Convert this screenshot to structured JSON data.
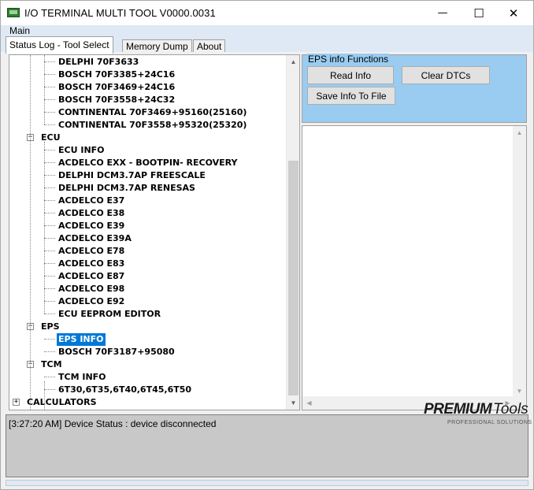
{
  "window": {
    "title": "I/O TERMINAL MULTI TOOL V0000.0031",
    "minimize_glyph": "—",
    "maximize_glyph": "☐",
    "close_glyph": "✕"
  },
  "menu": {
    "main_label": "Main"
  },
  "tabs": [
    {
      "label": "Status Log - Tool Select",
      "active": true
    },
    {
      "label": "Memory Dump",
      "active": false
    },
    {
      "label": "About",
      "active": false
    }
  ],
  "tree": {
    "items": [
      {
        "label": "DELPHI 70F3633"
      },
      {
        "label": "BOSCH 70F3385+24C16"
      },
      {
        "label": "BOSCH 70F3469+24C16"
      },
      {
        "label": "BOSCH 70F3558+24C32"
      },
      {
        "label": "CONTINENTAL 70F3469+95160(25160)"
      },
      {
        "label": "CONTINENTAL 70F3558+95320(25320)"
      },
      {
        "label": "ECU",
        "expander": "−"
      },
      {
        "label": "ECU INFO"
      },
      {
        "label": "ACDELCO EXX - BOOTPIN- RECOVERY"
      },
      {
        "label": "DELPHI DCM3.7AP FREESCALE"
      },
      {
        "label": "DELPHI DCM3.7AP RENESAS"
      },
      {
        "label": "ACDELCO E37"
      },
      {
        "label": "ACDELCO E38"
      },
      {
        "label": "ACDELCO E39"
      },
      {
        "label": "ACDELCO E39A"
      },
      {
        "label": "ACDELCO E78"
      },
      {
        "label": "ACDELCO E83"
      },
      {
        "label": "ACDELCO E87"
      },
      {
        "label": "ACDELCO E98"
      },
      {
        "label": "ACDELCO E92"
      },
      {
        "label": "ECU EEPROM EDITOR"
      },
      {
        "label": "EPS",
        "expander": "−"
      },
      {
        "label": "EPS INFO",
        "selected": true
      },
      {
        "label": "BOSCH 70F3187+95080"
      },
      {
        "label": "TCM",
        "expander": "−"
      },
      {
        "label": "TCM INFO"
      },
      {
        "label": "6T30,6T35,6T40,6T45,6T50"
      },
      {
        "label": "CALCULATORS",
        "expander": "+"
      }
    ],
    "scroll_up": "▲",
    "scroll_down": "▼"
  },
  "eps_group": {
    "title": "EPS info Functions",
    "read_info": "Read Info",
    "clear_dtcs": "Clear DTCs",
    "save_info": "Save Info To File"
  },
  "output": {
    "scroll_up": "▲",
    "scroll_down": "▼",
    "scroll_left": "◀",
    "scroll_right": "▶"
  },
  "status": {
    "log_line": "[3:27:20 AM] Device Status : device disconnected"
  },
  "watermark": {
    "premium": "PREMIUM",
    "tools": "Tools",
    "sub": "PROFESSIONAL SOLUTIONS"
  },
  "colors": {
    "group_bg": "#99ccf0",
    "selection": "#0078d7",
    "menubar": "#dfe9f5",
    "status_bg": "#c8c8c8"
  }
}
